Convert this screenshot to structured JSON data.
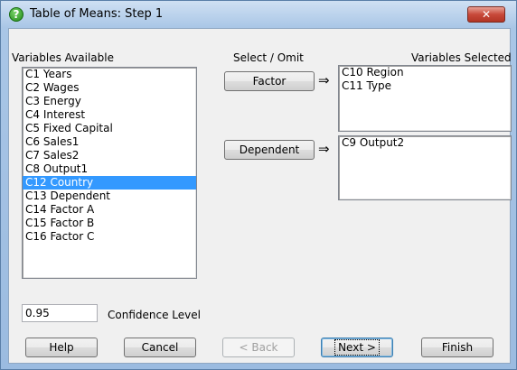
{
  "window": {
    "title": "Table of Means: Step 1",
    "close_glyph": "✕"
  },
  "labels": {
    "variables_available": "Variables Available",
    "select_omit": "Select / Omit",
    "variables_selected": "Variables Selected",
    "confidence_level": "Confidence Level"
  },
  "variables_available": [
    "C1 Years",
    "C2 Wages",
    "C3 Energy",
    "C4 Interest",
    "C5 Fixed Capital",
    "C6 Sales1",
    "C7 Sales2",
    "C8 Output1",
    "C12 Country",
    "C13 Dependent",
    "C14 Factor A",
    "C15 Factor B",
    "C16 Factor C"
  ],
  "selected_available_index": 8,
  "factor_button": "Factor",
  "factor_list": [
    "C10 Region",
    "C11 Type"
  ],
  "dependent_button": "Dependent",
  "dependent_list": [
    "C9 Output2"
  ],
  "arrow_glyph": "⇒",
  "confidence_value": "0.95",
  "buttons": {
    "help": "Help",
    "cancel": "Cancel",
    "back": "< Back",
    "next": "Next >",
    "finish": "Finish"
  },
  "colors": {
    "selection": "#3399ff",
    "close_button": "#c8493a"
  },
  "icons": {
    "title_icon": "help-question-icon",
    "close_icon": "close-icon",
    "arrow_icon": "right-double-arrow-icon"
  }
}
